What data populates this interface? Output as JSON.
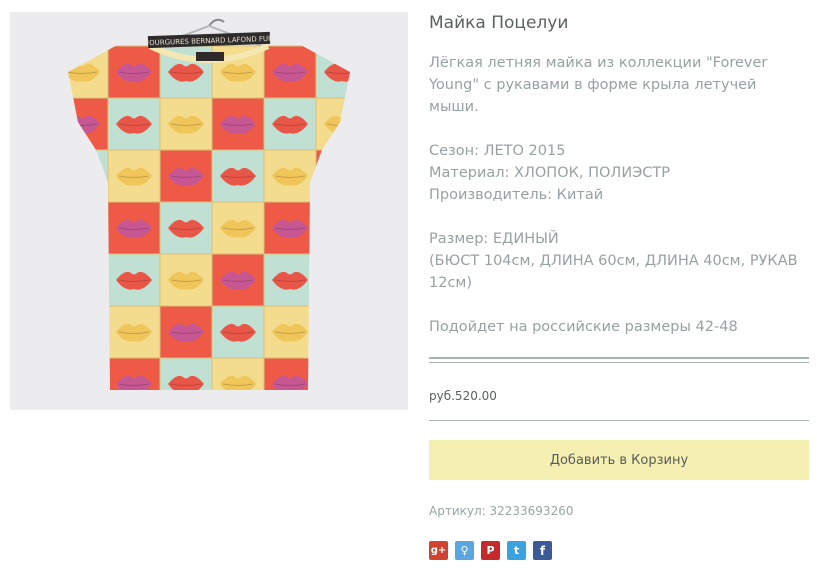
{
  "product": {
    "title": "Майка Поцелуи",
    "description": "Лёгкая летняя майка из коллекции \"Forever Young\" с рукавами в форме крыла летучей мыши.",
    "season": "Сезон: ЛЕТО 2015",
    "material": "Материал: ХЛОПОК, ПОЛИЭСТР",
    "manufacturer": "Производитель: Китай",
    "size_label": "Размер: ЕДИНЫЙ",
    "size_details": "(БЮСТ 104см, ДЛИНА 60см, ДЛИНА 40см, РУКАВ 12см)",
    "fit_note": "Подойдет на российские размеры 42-48",
    "price": "руб.520.00",
    "add_to_cart_label": "Добавить в Корзину",
    "sku": "Артикул: 32233693260",
    "image_label": "FOURGURES BERNARD LAFOND FUR"
  },
  "share": [
    {
      "name": "google-plus-icon",
      "glyph": "g+",
      "color": "#d0432f"
    },
    {
      "name": "vk-icon",
      "glyph": "♀",
      "color": "#5ba6dd"
    },
    {
      "name": "pinterest-icon",
      "glyph": "P",
      "color": "#c42a2a"
    },
    {
      "name": "twitter-icon",
      "glyph": "t",
      "color": "#3ba2e0"
    },
    {
      "name": "facebook-icon",
      "glyph": "f",
      "color": "#3a5a98"
    }
  ],
  "colors": {
    "cart_button_bg": "#f6efb2",
    "text_muted": "#97a1a4",
    "title_text": "#5b6063"
  }
}
